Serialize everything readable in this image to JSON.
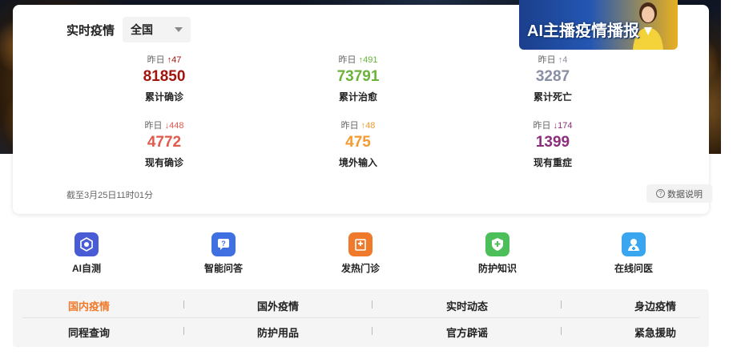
{
  "header": {
    "title": "实时疫情",
    "region": "全国",
    "banner_text": "AI主播疫情播报"
  },
  "stats": [
    {
      "delta_label": "昨日",
      "delta_arrow": "↑",
      "delta_value": "47",
      "value": "81850",
      "label": "累计确诊",
      "color": "#a3140d",
      "delta_color": "#a3140d"
    },
    {
      "delta_label": "昨日",
      "delta_arrow": "↑",
      "delta_value": "491",
      "value": "73791",
      "label": "累计治愈",
      "color": "#6bb33a",
      "delta_color": "#6bb33a"
    },
    {
      "delta_label": "昨日",
      "delta_arrow": "↑",
      "delta_value": "4",
      "value": "3287",
      "label": "累计死亡",
      "color": "#8a8fa3",
      "delta_color": "#8a8fa3"
    },
    {
      "delta_label": "昨日",
      "delta_arrow": "↓",
      "delta_value": "448",
      "value": "4772",
      "label": "现有确诊",
      "color": "#e05a4e",
      "delta_color": "#e05a4e"
    },
    {
      "delta_label": "昨日",
      "delta_arrow": "↑",
      "delta_value": "48",
      "value": "475",
      "label": "境外输入",
      "color": "#f39a30",
      "delta_color": "#f39a30"
    },
    {
      "delta_label": "昨日",
      "delta_arrow": "↓",
      "delta_value": "174",
      "value": "1399",
      "label": "现有重症",
      "color": "#8b2f7c",
      "delta_color": "#8b2f7c"
    }
  ],
  "footer": {
    "timestamp": "截至3月25日11时01分",
    "data_note": "数据说明",
    "data_note_icon": "?"
  },
  "tools": [
    {
      "label": "AI自测",
      "icon": "ai-test-icon",
      "color": "#4a5bd6"
    },
    {
      "label": "智能问答",
      "icon": "chat-question-icon",
      "color": "#3f6fe0"
    },
    {
      "label": "发热门诊",
      "icon": "hospital-icon",
      "color": "#f07a2b"
    },
    {
      "label": "防护知识",
      "icon": "shield-icon",
      "color": "#4cbf5a"
    },
    {
      "label": "在线问医",
      "icon": "doctor-icon",
      "color": "#3aa6f0"
    }
  ],
  "nav": {
    "row1": [
      "国内疫情",
      "国外疫情",
      "实时动态",
      "身边疫情"
    ],
    "row2": [
      "同程查询",
      "防护用品",
      "官方辟谣",
      "紧急援助"
    ],
    "active_color": "#f07a2b"
  }
}
